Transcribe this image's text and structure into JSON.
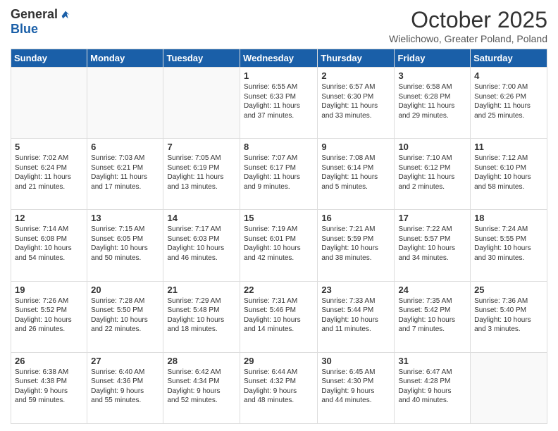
{
  "header": {
    "logo_general": "General",
    "logo_blue": "Blue",
    "month_title": "October 2025",
    "location": "Wielichowo, Greater Poland, Poland"
  },
  "weekdays": [
    "Sunday",
    "Monday",
    "Tuesday",
    "Wednesday",
    "Thursday",
    "Friday",
    "Saturday"
  ],
  "weeks": [
    [
      {
        "day": "",
        "info": ""
      },
      {
        "day": "",
        "info": ""
      },
      {
        "day": "",
        "info": ""
      },
      {
        "day": "1",
        "info": "Sunrise: 6:55 AM\nSunset: 6:33 PM\nDaylight: 11 hours\nand 37 minutes."
      },
      {
        "day": "2",
        "info": "Sunrise: 6:57 AM\nSunset: 6:30 PM\nDaylight: 11 hours\nand 33 minutes."
      },
      {
        "day": "3",
        "info": "Sunrise: 6:58 AM\nSunset: 6:28 PM\nDaylight: 11 hours\nand 29 minutes."
      },
      {
        "day": "4",
        "info": "Sunrise: 7:00 AM\nSunset: 6:26 PM\nDaylight: 11 hours\nand 25 minutes."
      }
    ],
    [
      {
        "day": "5",
        "info": "Sunrise: 7:02 AM\nSunset: 6:24 PM\nDaylight: 11 hours\nand 21 minutes."
      },
      {
        "day": "6",
        "info": "Sunrise: 7:03 AM\nSunset: 6:21 PM\nDaylight: 11 hours\nand 17 minutes."
      },
      {
        "day": "7",
        "info": "Sunrise: 7:05 AM\nSunset: 6:19 PM\nDaylight: 11 hours\nand 13 minutes."
      },
      {
        "day": "8",
        "info": "Sunrise: 7:07 AM\nSunset: 6:17 PM\nDaylight: 11 hours\nand 9 minutes."
      },
      {
        "day": "9",
        "info": "Sunrise: 7:08 AM\nSunset: 6:14 PM\nDaylight: 11 hours\nand 5 minutes."
      },
      {
        "day": "10",
        "info": "Sunrise: 7:10 AM\nSunset: 6:12 PM\nDaylight: 11 hours\nand 2 minutes."
      },
      {
        "day": "11",
        "info": "Sunrise: 7:12 AM\nSunset: 6:10 PM\nDaylight: 10 hours\nand 58 minutes."
      }
    ],
    [
      {
        "day": "12",
        "info": "Sunrise: 7:14 AM\nSunset: 6:08 PM\nDaylight: 10 hours\nand 54 minutes."
      },
      {
        "day": "13",
        "info": "Sunrise: 7:15 AM\nSunset: 6:05 PM\nDaylight: 10 hours\nand 50 minutes."
      },
      {
        "day": "14",
        "info": "Sunrise: 7:17 AM\nSunset: 6:03 PM\nDaylight: 10 hours\nand 46 minutes."
      },
      {
        "day": "15",
        "info": "Sunrise: 7:19 AM\nSunset: 6:01 PM\nDaylight: 10 hours\nand 42 minutes."
      },
      {
        "day": "16",
        "info": "Sunrise: 7:21 AM\nSunset: 5:59 PM\nDaylight: 10 hours\nand 38 minutes."
      },
      {
        "day": "17",
        "info": "Sunrise: 7:22 AM\nSunset: 5:57 PM\nDaylight: 10 hours\nand 34 minutes."
      },
      {
        "day": "18",
        "info": "Sunrise: 7:24 AM\nSunset: 5:55 PM\nDaylight: 10 hours\nand 30 minutes."
      }
    ],
    [
      {
        "day": "19",
        "info": "Sunrise: 7:26 AM\nSunset: 5:52 PM\nDaylight: 10 hours\nand 26 minutes."
      },
      {
        "day": "20",
        "info": "Sunrise: 7:28 AM\nSunset: 5:50 PM\nDaylight: 10 hours\nand 22 minutes."
      },
      {
        "day": "21",
        "info": "Sunrise: 7:29 AM\nSunset: 5:48 PM\nDaylight: 10 hours\nand 18 minutes."
      },
      {
        "day": "22",
        "info": "Sunrise: 7:31 AM\nSunset: 5:46 PM\nDaylight: 10 hours\nand 14 minutes."
      },
      {
        "day": "23",
        "info": "Sunrise: 7:33 AM\nSunset: 5:44 PM\nDaylight: 10 hours\nand 11 minutes."
      },
      {
        "day": "24",
        "info": "Sunrise: 7:35 AM\nSunset: 5:42 PM\nDaylight: 10 hours\nand 7 minutes."
      },
      {
        "day": "25",
        "info": "Sunrise: 7:36 AM\nSunset: 5:40 PM\nDaylight: 10 hours\nand 3 minutes."
      }
    ],
    [
      {
        "day": "26",
        "info": "Sunrise: 6:38 AM\nSunset: 4:38 PM\nDaylight: 9 hours\nand 59 minutes."
      },
      {
        "day": "27",
        "info": "Sunrise: 6:40 AM\nSunset: 4:36 PM\nDaylight: 9 hours\nand 55 minutes."
      },
      {
        "day": "28",
        "info": "Sunrise: 6:42 AM\nSunset: 4:34 PM\nDaylight: 9 hours\nand 52 minutes."
      },
      {
        "day": "29",
        "info": "Sunrise: 6:44 AM\nSunset: 4:32 PM\nDaylight: 9 hours\nand 48 minutes."
      },
      {
        "day": "30",
        "info": "Sunrise: 6:45 AM\nSunset: 4:30 PM\nDaylight: 9 hours\nand 44 minutes."
      },
      {
        "day": "31",
        "info": "Sunrise: 6:47 AM\nSunset: 4:28 PM\nDaylight: 9 hours\nand 40 minutes."
      },
      {
        "day": "",
        "info": ""
      }
    ]
  ]
}
